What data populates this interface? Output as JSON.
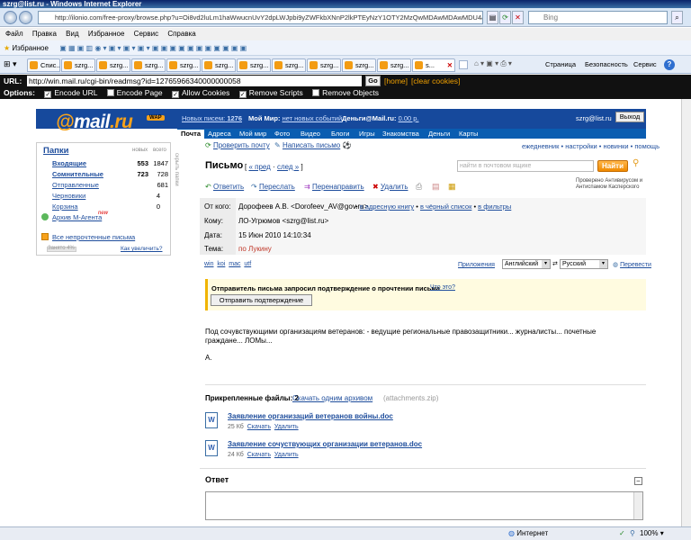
{
  "browser": {
    "title": "szrg@list.ru - Windows Internet Explorer",
    "url": "http://ilonio.com/free-proxy/browse.php?u=Oi8vd2luLm1haWwucnUvY2dpLWJpbi9yZWFkbXNnP2lkPTEyNzY1OTY2MzQwMDAwMDAwMDU4&b=13",
    "search_placeholder": "Bing",
    "menu": [
      "Файл",
      "Правка",
      "Вид",
      "Избранное",
      "Сервис",
      "Справка"
    ],
    "favorites_label": "Избранное",
    "tabs": [
      "Спис...",
      "szrg...",
      "szrg...",
      "szrg...",
      "szrg...",
      "szrg...",
      "szrg...",
      "szrg...",
      "szrg...",
      "szrg...",
      "szrg...",
      "s..."
    ],
    "toolbar_right": [
      "Страница",
      "Безопасность",
      "Сервис"
    ],
    "status_zone": "Интернет",
    "zoom": "100%"
  },
  "proxy": {
    "url_label": "URL:",
    "url": "http://win.mail.ru/cgi-bin/readmsg?id=12765966340000000058",
    "go": "Go",
    "home": "[home]",
    "clear": "[clear cookies]",
    "options_label": "Options:",
    "options": [
      "Encode URL",
      "Encode Page",
      "Allow Cookies",
      "Remove Scripts",
      "Remove Objects"
    ],
    "options_checked": [
      true,
      false,
      true,
      true,
      false
    ]
  },
  "mail": {
    "logo_at": "@",
    "logo_text": "mail",
    "logo_ru": ".ru",
    "logo_badge": "WAP",
    "header": {
      "new_messages_label": "Новых писем:",
      "new_messages_count": "1276",
      "moy_mir_label": "Мой Мир:",
      "moy_mir_value": "нет новых событий",
      "money_label": "Деньги@Mail.ru:",
      "money_value": "0.00 р.",
      "user": "szrg@list.ru",
      "logout": "Выход"
    },
    "nav": [
      "Почта",
      "Адреса",
      "Мой мир",
      "Фото",
      "Видео",
      "Блоги",
      "Игры",
      "Знакомства",
      "Деньги",
      "Карты"
    ],
    "subnav_left": [
      "Проверить почту",
      "Написать письмо"
    ],
    "subnav_right": "ежедневник • настройки • новинки • помощь",
    "folders": {
      "title": "Папки",
      "col_new": "новых",
      "col_total": "всего",
      "items": [
        {
          "name": "Входящие",
          "new": "553",
          "total": "1847"
        },
        {
          "name": "Сомнительные",
          "new": "723",
          "total": "728"
        },
        {
          "name": "Отправленные",
          "new": "",
          "total": "681"
        },
        {
          "name": "Черновики",
          "new": "",
          "total": "4"
        },
        {
          "name": "Корзина",
          "new": "",
          "total": "0"
        },
        {
          "name": "Архив М-Агента",
          "new": "",
          "total": ""
        }
      ],
      "new_badge": "new",
      "all_unread": "Все непрочтенные письма",
      "used": "Занято 4%",
      "increase": "Как увеличить?",
      "hide": "скрыть папки"
    },
    "letter": {
      "title": "Письмо",
      "prev": "« пред",
      "next": "след »",
      "search_placeholder": "найти в почтовом ящике",
      "search_btn": "Найти",
      "actions": [
        "Ответить",
        "Переслать",
        "Перенаправить",
        "Удалить"
      ],
      "antivirus": "Проверено Антивирусом и Антиспамом Касперского",
      "from_label": "От кого:",
      "from": "Дорофеев А.В. <Dorofeev_AV@gov.ru>",
      "from_links": [
        "в адресную книгу",
        "в чёрный список",
        "в фильтры"
      ],
      "to_label": "Кому:",
      "to": "ЛО-Угрюмов <szrg@list.ru>",
      "date_label": "Дата:",
      "date": "15 Июн 2010 14:10:34",
      "subject_label": "Тема:",
      "subject": "по Лукину",
      "encodings": [
        "win",
        "koi",
        "mac",
        "utf"
      ],
      "apps": "Приложения",
      "lang_from": "Английский",
      "lang_to": "Русский",
      "translate": "Перевести",
      "receipt_text": "Отправитель письма запросил подтверждение о прочтении письма.",
      "receipt_what": "Что это?",
      "receipt_btn": "Отправить подтверждение",
      "body": "Под сочувствующими организациям ветеранов: - ведущие региональные правозащитники... журналисты... почетные граждане... ЛОМы...",
      "sign": "А.",
      "attach_label": "Прикрепленные файлы: 2",
      "attach_all": "Скачать одним архивом",
      "attach_zip": "(attachments.zip)",
      "files": [
        {
          "name": "Заявление организаций ветеранов войны.doc",
          "size": "25 Кб",
          "download": "Скачать",
          "delete": "Удалить"
        },
        {
          "name": "Заявление сочуствующих организации ветеранов.doc",
          "size": "24 Кб",
          "download": "Скачать",
          "delete": "Удалить"
        }
      ],
      "reply_title": "Ответ"
    }
  }
}
